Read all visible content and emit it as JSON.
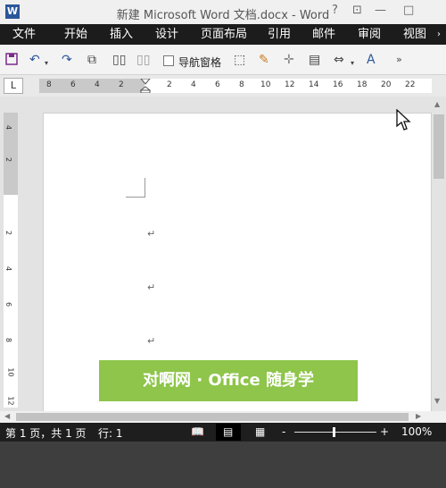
{
  "window": {
    "title": "新建 Microsoft Word 文档.docx - Word",
    "app_icon": "W",
    "help": "?",
    "restore": "⊡",
    "minimize": "—"
  },
  "tabs": [
    "文件",
    "开始",
    "插入",
    "设计",
    "页面布局",
    "引用",
    "邮件",
    "审阅",
    "视图"
  ],
  "toolbar": {
    "nav_pane_label": "导航窗格",
    "nav_pane_checked": false
  },
  "ruler": {
    "corner": "L",
    "h_ticks": [
      "8",
      "6",
      "4",
      "2",
      "2",
      "4",
      "6",
      "8",
      "10",
      "12",
      "14",
      "16",
      "18",
      "20",
      "22"
    ],
    "v_ticks": [
      "4",
      "2",
      "2",
      "4",
      "6",
      "8",
      "10",
      "12"
    ]
  },
  "document": {
    "paragraph_mark": "↵",
    "banner_text": "对啊网 · Office 随身学"
  },
  "status": {
    "page": "第 1 页，共 1 页",
    "line": "行: 1",
    "zoom_minus": "-",
    "zoom_plus": "+",
    "zoom": "100%",
    "zoom_level_percent": 100
  },
  "colors": {
    "banner_bg": "#8ec54a",
    "ribbon_bg": "#1c1c1c",
    "status_bg": "#1e1e1e"
  }
}
